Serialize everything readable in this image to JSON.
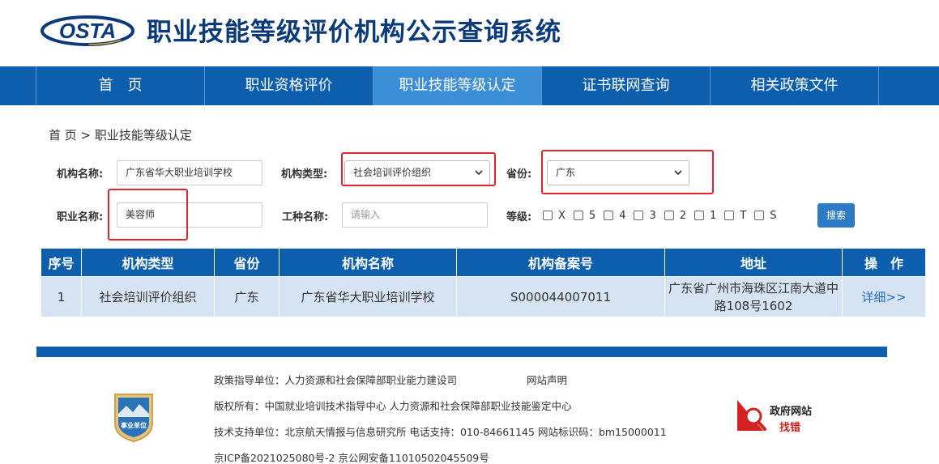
{
  "header": {
    "logo_text": "OSTA",
    "title": "职业技能等级评价机构公示查询系统"
  },
  "nav": [
    {
      "label": "首　页",
      "active": false
    },
    {
      "label": "职业资格评价",
      "active": false
    },
    {
      "label": "职业技能等级认定",
      "active": true
    },
    {
      "label": "证书联网查询",
      "active": false
    },
    {
      "label": "相关政策文件",
      "active": false
    }
  ],
  "breadcrumb": "首 页 > 职业技能等级认定",
  "form": {
    "org_name_label": "机构名称:",
    "org_name_value": "广东省华大职业培训学校",
    "org_type_label": "机构类型:",
    "org_type_value": "社会培训评价组织",
    "province_label": "省份:",
    "province_value": "广东",
    "occupation_label": "职业名称:",
    "occupation_value": "美容师",
    "job_type_label": "工种名称:",
    "job_type_placeholder": "请输入",
    "level_label": "等级:",
    "levels": [
      "X",
      "5",
      "4",
      "3",
      "2",
      "1",
      "T",
      "S"
    ],
    "search_label": "搜索"
  },
  "table": {
    "headers": [
      "序号",
      "机构类型",
      "省份",
      "机构名称",
      "机构备案号",
      "地址",
      "操　作"
    ],
    "rows": [
      {
        "no": "1",
        "type": "社会培训评价组织",
        "province": "广东",
        "name": "广东省华大职业培训学校",
        "record_no": "S000044007011",
        "address": "广东省广州市海珠区江南大道中路108号1602",
        "action": "详细>>"
      }
    ]
  },
  "footer": {
    "guide_unit": "政策指导单位：人力资源和社会保障部职业能力建设司",
    "statement": "网站声明",
    "copyright": "版权所有：中国就业培训技术指导中心 人力资源和社会保障部职业技能鉴定中心",
    "support": "技术支持单位：北京航天情报与信息研究所   电话支持：010-84661145   网站标识码：bm15000011",
    "icp": "京ICP备2021025080号-2    京公网安备11010502045509号",
    "badge_text": "事业单位",
    "gov_line1": "政府网站",
    "gov_line2": "找错"
  },
  "colors": {
    "brand_blue": "#0d5fae",
    "active_tab": "#3c8fd6",
    "highlight_red": "#e0262c",
    "row_bg": "#d6e3f3"
  }
}
